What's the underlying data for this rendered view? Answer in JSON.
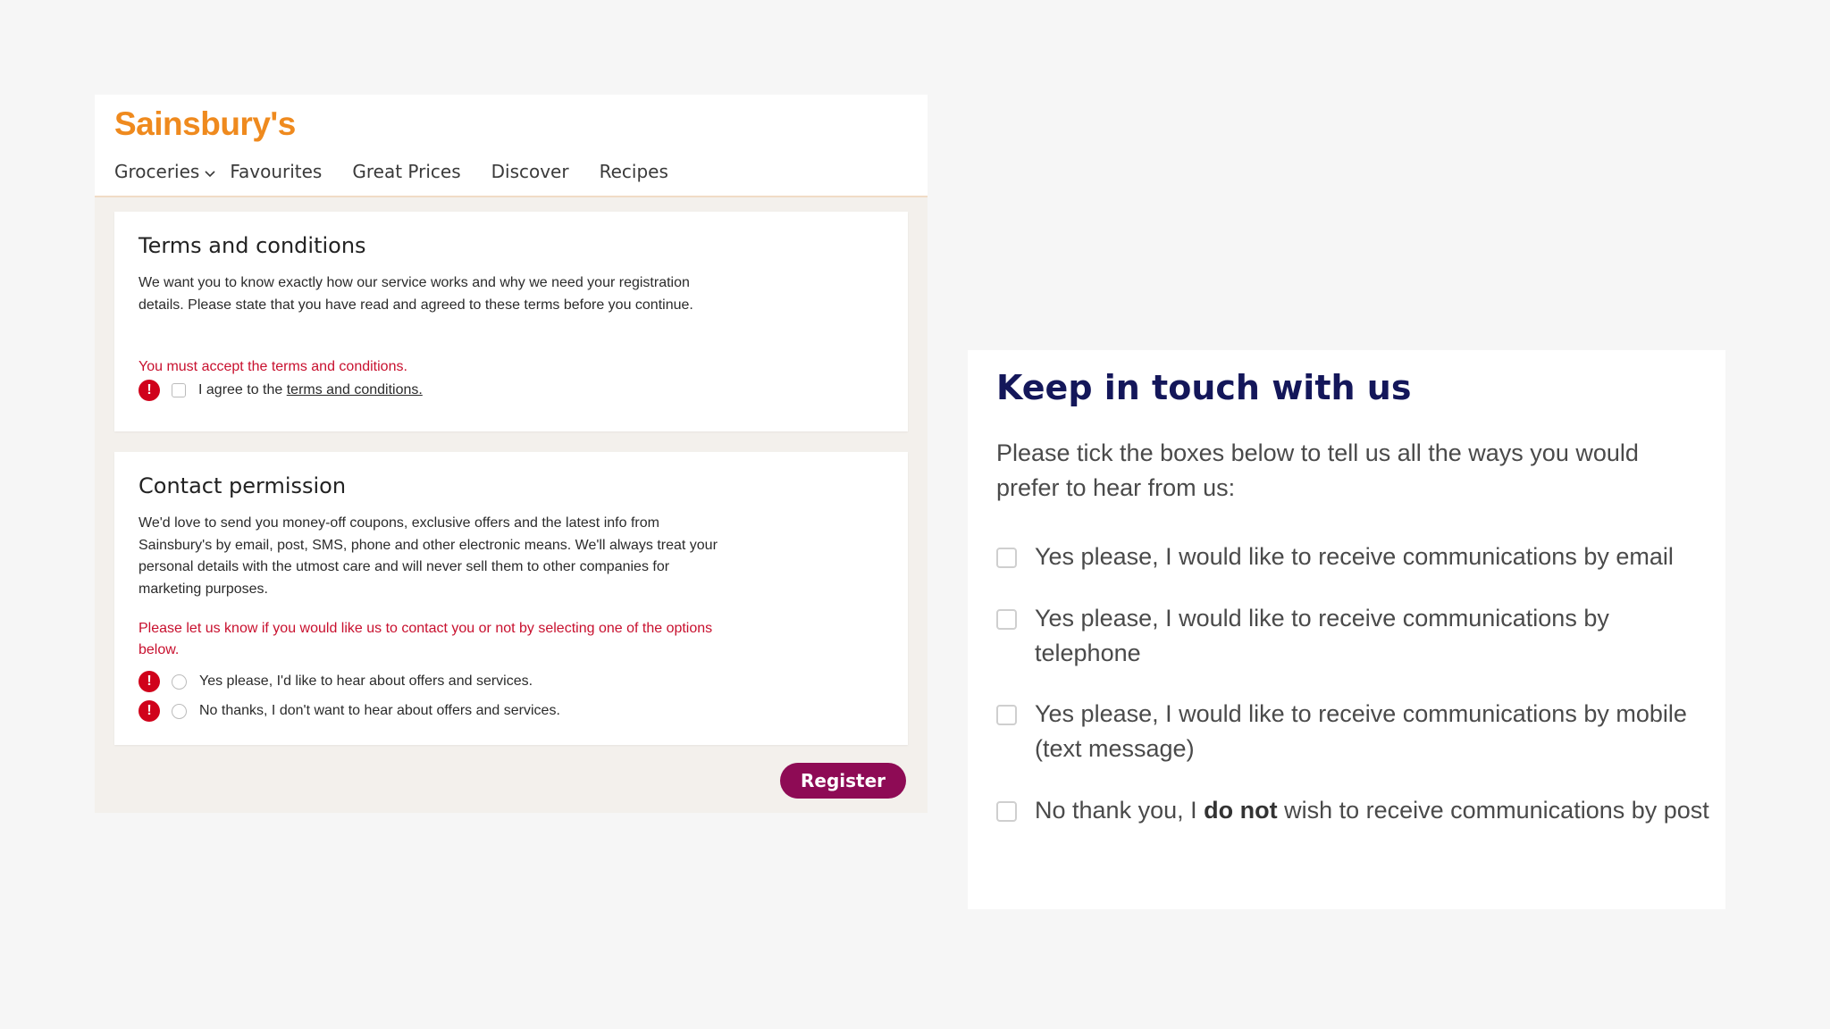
{
  "sainsburys": {
    "logo_text": "Sainsbury's",
    "brand_color": "#ef8a1e",
    "nav": {
      "groceries": "Groceries",
      "favourites": "Favourites",
      "great_prices": "Great Prices",
      "discover": "Discover",
      "recipes": "Recipes"
    },
    "terms": {
      "title": "Terms and conditions",
      "body": "We want you to know exactly how our service works and why we need your registration details. Please state that you have read and agreed to these terms before you continue.",
      "error": "You must accept the terms and conditions.",
      "agree_prefix": "I agree to the ",
      "agree_link": "terms and conditions."
    },
    "contact": {
      "title": "Contact permission",
      "body": "We'd love to send you money-off coupons, exclusive offers and the latest info from Sainsbury's by email, post, SMS, phone and other electronic means. We'll always treat your personal details with the utmost care and will never sell them to other companies for marketing purposes.",
      "error": "Please let us know if you would like us to contact you or not by selecting one of the options below.",
      "option_yes": "Yes please, I'd like to hear about offers and services.",
      "option_no": "No thanks, I don't want to hear about offers and services."
    },
    "register_label": "Register",
    "register_color": "#8e0b55",
    "error_color": "#c8102e"
  },
  "keep_in_touch": {
    "title": "Keep in touch with us",
    "title_color": "#14175a",
    "intro": "Please tick the boxes below to tell us all the ways you would prefer to hear from us:",
    "options": [
      {
        "text": "Yes please, I would like to receive communications by email"
      },
      {
        "text": "Yes please, I would like to receive communications by telephone"
      },
      {
        "text": "Yes please, I would like to receive communications by mobile (text message)"
      },
      {
        "before": "No thank you, I ",
        "bold": "do not",
        "after": " wish to receive communications by post"
      }
    ]
  }
}
